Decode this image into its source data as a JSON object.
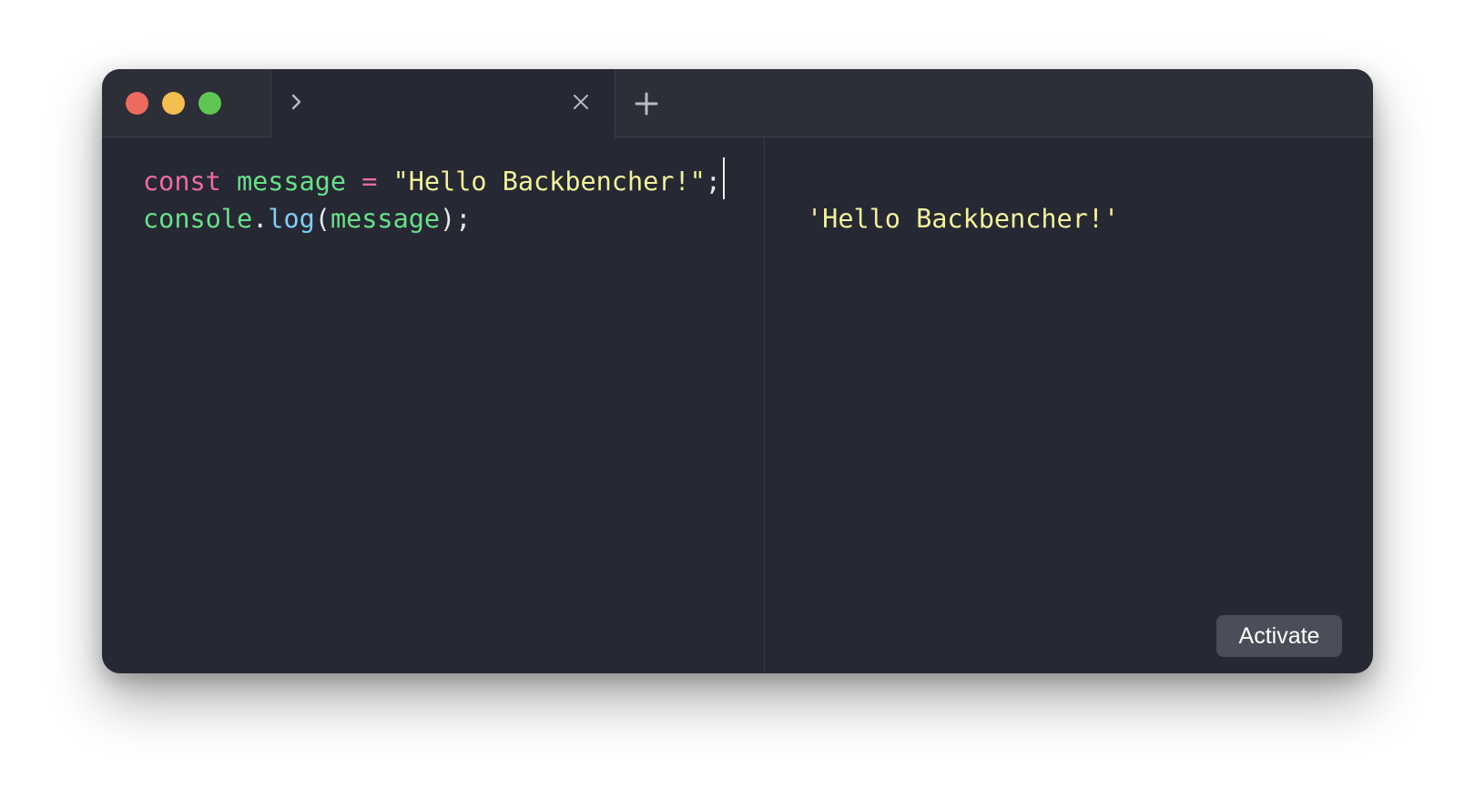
{
  "window": {
    "controls": [
      "close",
      "minimize",
      "maximize"
    ],
    "colors": {
      "close": "#ed6a5e",
      "minimize": "#f5bf4f",
      "maximize": "#61c554",
      "background": "#262833"
    }
  },
  "tab": {
    "icon": "chevron-right-icon",
    "close_icon": "close-icon",
    "new_tab_icon": "plus-icon"
  },
  "editor": {
    "lines": [
      {
        "tokens": [
          {
            "text": "const",
            "type": "keyword"
          },
          {
            "text": " ",
            "type": "space"
          },
          {
            "text": "message",
            "type": "variable"
          },
          {
            "text": " ",
            "type": "space"
          },
          {
            "text": "=",
            "type": "operator"
          },
          {
            "text": " ",
            "type": "space"
          },
          {
            "text": "\"Hello Backbencher!\"",
            "type": "string"
          },
          {
            "text": ";",
            "type": "punctuation"
          }
        ]
      },
      {
        "tokens": [
          {
            "text": "console",
            "type": "variable"
          },
          {
            "text": ".",
            "type": "punctuation"
          },
          {
            "text": "log",
            "type": "function"
          },
          {
            "text": "(",
            "type": "punctuation"
          },
          {
            "text": "message",
            "type": "variable"
          },
          {
            "text": ");",
            "type": "punctuation"
          }
        ]
      }
    ],
    "syntax_colors": {
      "keyword": "#ef6aa8",
      "variable": "#68e18a",
      "operator": "#ef6aa8",
      "string": "#f1f29a",
      "punctuation": "#e8e8e8",
      "function": "#7fcff6"
    }
  },
  "output": {
    "result": "'Hello Backbencher!'"
  },
  "activate_label": "Activate"
}
